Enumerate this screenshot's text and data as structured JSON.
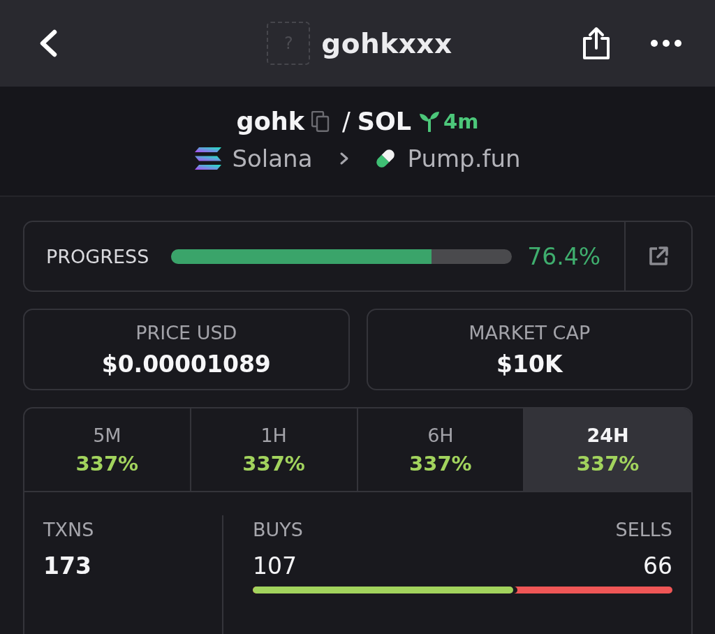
{
  "header": {
    "title": "gohkxxx",
    "avatar_placeholder": "?"
  },
  "pair": {
    "base": "gohk",
    "separator": "/",
    "quote": "SOL",
    "age": "4m"
  },
  "breadcrumb": {
    "chain": "Solana",
    "platform": "Pump.fun"
  },
  "progress": {
    "label": "PROGRESS",
    "level": 0.764,
    "reading": "76.4%"
  },
  "summary_cards": [
    {
      "label": "PRICE USD",
      "value": "$0.00001089"
    },
    {
      "label": "MARKET CAP",
      "value": "$10K"
    }
  ],
  "timeframes": [
    {
      "label": "5M",
      "change": "337%",
      "selected": false
    },
    {
      "label": "1H",
      "change": "337%",
      "selected": false
    },
    {
      "label": "6H",
      "change": "337%",
      "selected": false
    },
    {
      "label": "24H",
      "change": "337%",
      "selected": true
    }
  ],
  "transactions": {
    "total_label": "TXNS",
    "total": "173",
    "buys_label": "BUYS",
    "buys": "107",
    "sells_label": "SELLS",
    "sells": "66",
    "level": 0.62
  }
}
